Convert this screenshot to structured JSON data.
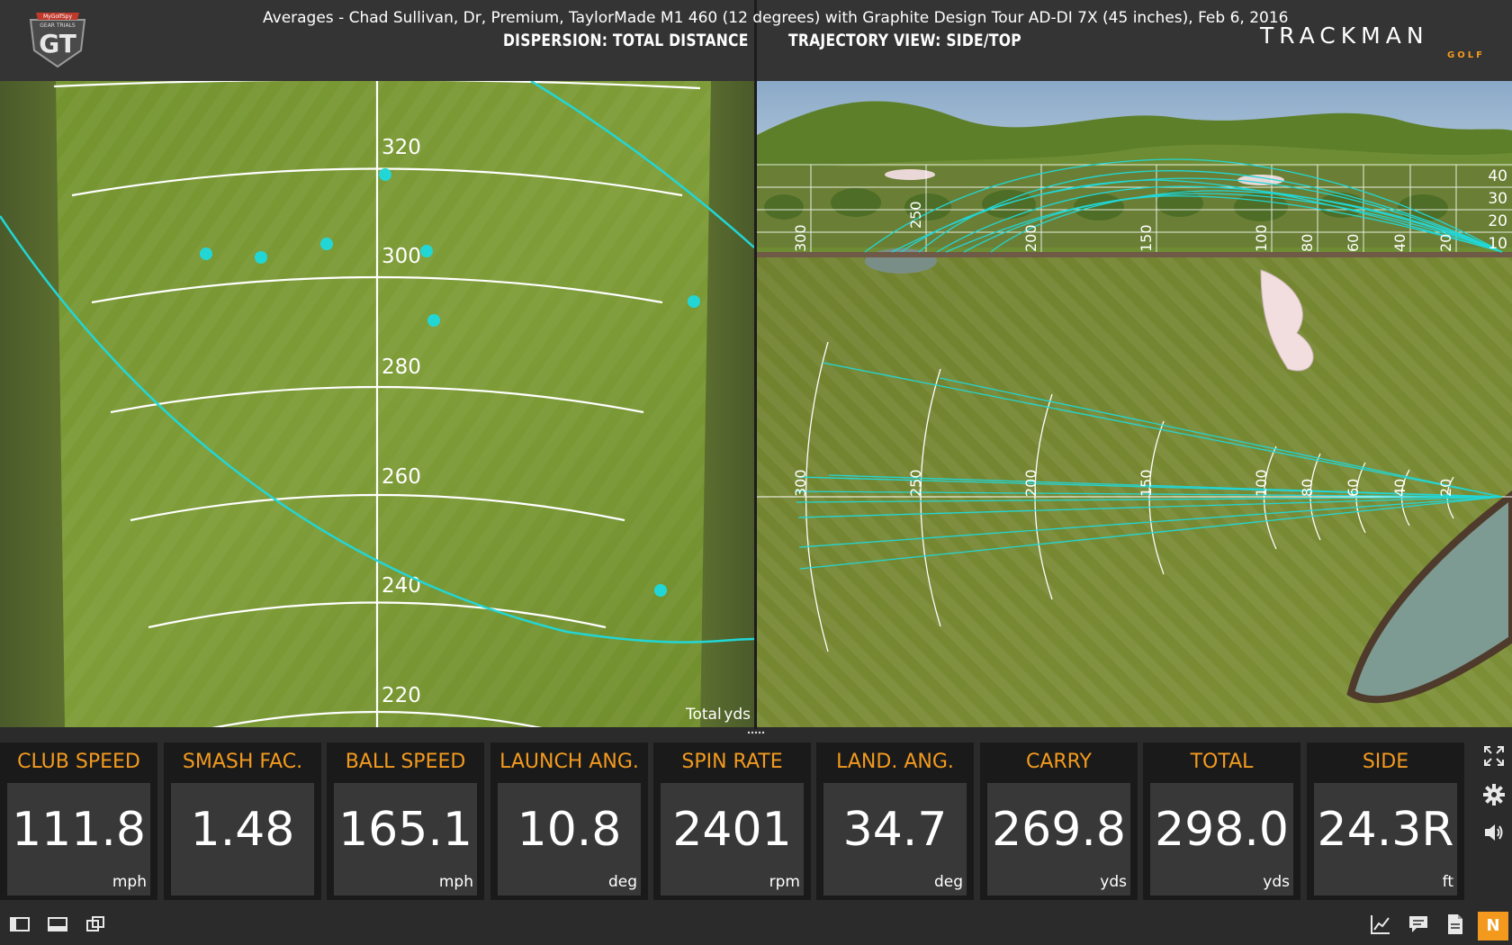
{
  "header": {
    "left_title": "DISPERSION: TOTAL DISTANCE",
    "right_title": "TRAJECTORY VIEW: SIDE/TOP",
    "brand": "TRACKMAN",
    "brand_sub": "GOLF",
    "logo_text": "GT",
    "logo_sub": "GEAR TRIALS",
    "logo_top": "MyGolfSpy"
  },
  "dispersion": {
    "distance_labels": [
      "320",
      "300",
      "280",
      "260",
      "240",
      "220"
    ],
    "axis_label": "Total",
    "axis_unit": "yds"
  },
  "trajectory": {
    "side_distance_labels": [
      "300",
      "250",
      "200",
      "150",
      "100",
      "80",
      "60",
      "40",
      "20"
    ],
    "height_labels": [
      "40",
      "30",
      "20",
      "10"
    ],
    "top_distance_labels": [
      "300",
      "250",
      "200",
      "150",
      "100",
      "80",
      "60",
      "40",
      "20"
    ]
  },
  "metrics": [
    {
      "label": "CLUB SPEED",
      "value": "111.8",
      "unit": "mph"
    },
    {
      "label": "SMASH FAC.",
      "value": "1.48",
      "unit": ""
    },
    {
      "label": "BALL SPEED",
      "value": "165.1",
      "unit": "mph"
    },
    {
      "label": "LAUNCH ANG.",
      "value": "10.8",
      "unit": "deg"
    },
    {
      "label": "SPIN RATE",
      "value": "2401",
      "unit": "rpm"
    },
    {
      "label": "LAND. ANG.",
      "value": "34.7",
      "unit": "deg"
    },
    {
      "label": "CARRY",
      "value": "269.8",
      "unit": "yds"
    },
    {
      "label": "TOTAL",
      "value": "298.0",
      "unit": "yds"
    },
    {
      "label": "SIDE",
      "value": "24.3R",
      "unit": "ft"
    }
  ],
  "side_tools": [
    "fullscreen-icon",
    "gear-icon",
    "speaker-icon"
  ],
  "footer": {
    "caption": "Averages - Chad Sullivan, Dr, Premium, TaylorMade M1 460 (12 degrees) with Graphite Design Tour AD-DI 7X (45 inches), Feb 6, 2016",
    "n_button": "N"
  },
  "colors": {
    "accent": "#f39a1e",
    "shot": "#22d6d6",
    "panel": "#343434",
    "tile_box": "#383838"
  }
}
